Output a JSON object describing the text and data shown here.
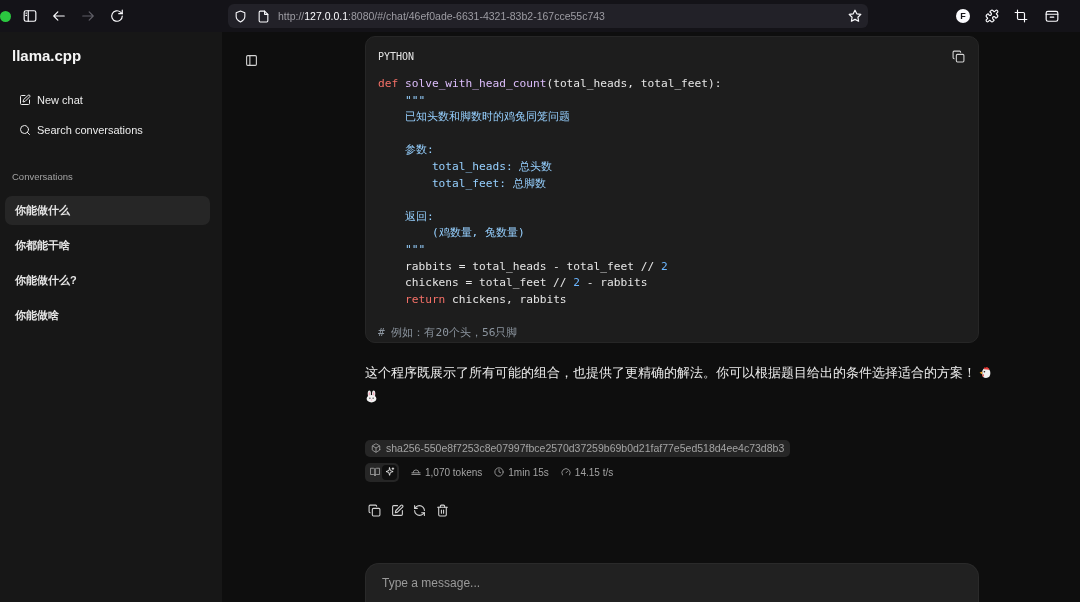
{
  "browser": {
    "nav_buttons": [
      {
        "kind": "back",
        "disabled": false
      },
      {
        "kind": "forward",
        "disabled": true
      },
      {
        "kind": "reload",
        "disabled": false
      }
    ],
    "url": {
      "scheme": "http://",
      "host": "127.0.0.1",
      "rest": ":8080/#/chat/46ef0ade-6631-4321-83b2-167cce55c743"
    },
    "profile_initial": "F"
  },
  "sidebar": {
    "title": "llama.cpp",
    "actions": [
      {
        "kind": "new_chat",
        "label": "New chat"
      },
      {
        "kind": "search",
        "label": "Search conversations"
      }
    ],
    "section_label": "Conversations",
    "conversations": [
      {
        "title": "你能做什么",
        "selected": true
      },
      {
        "title": "你都能干啥",
        "selected": false
      },
      {
        "title": "你能做什么?",
        "selected": false
      },
      {
        "title": "你能做啥",
        "selected": false
      }
    ]
  },
  "code_block": {
    "language": "PYTHON",
    "lines": [
      {
        "kind": "code",
        "tokens": [
          {
            "kind": "keyword",
            "text": "def"
          },
          {
            "kind": "function",
            "text": " solve_with_head_count"
          },
          {
            "kind": "plain",
            "text": "(total_heads, total_feet):"
          }
        ]
      },
      {
        "kind": "code",
        "tokens": [
          {
            "kind": "string",
            "text": "    \"\"\""
          }
        ]
      },
      {
        "kind": "code",
        "tokens": [
          {
            "kind": "string",
            "text": "    已知头数和脚数时的鸡兔同笼问题"
          }
        ]
      },
      {
        "kind": "blank"
      },
      {
        "kind": "code",
        "tokens": [
          {
            "kind": "string",
            "text": "    参数:"
          }
        ]
      },
      {
        "kind": "code",
        "tokens": [
          {
            "kind": "string",
            "text": "        total_heads: 总头数"
          }
        ]
      },
      {
        "kind": "code",
        "tokens": [
          {
            "kind": "string",
            "text": "        total_feet: 总脚数"
          }
        ]
      },
      {
        "kind": "blank"
      },
      {
        "kind": "code",
        "tokens": [
          {
            "kind": "string",
            "text": "    返回:"
          }
        ]
      },
      {
        "kind": "code",
        "tokens": [
          {
            "kind": "string",
            "text": "        (鸡数量, 兔数量)"
          }
        ]
      },
      {
        "kind": "code",
        "tokens": [
          {
            "kind": "string",
            "text": "    \"\"\""
          }
        ]
      },
      {
        "kind": "code",
        "tokens": [
          {
            "kind": "plain",
            "text": "    rabbits = total_heads - total_feet // "
          },
          {
            "kind": "number",
            "text": "2"
          }
        ]
      },
      {
        "kind": "code",
        "tokens": [
          {
            "kind": "plain",
            "text": "    chickens = total_feet // "
          },
          {
            "kind": "number",
            "text": "2"
          },
          {
            "kind": "plain",
            "text": " - rabbits"
          }
        ]
      },
      {
        "kind": "code",
        "tokens": [
          {
            "kind": "keyword",
            "text": "    return"
          },
          {
            "kind": "plain",
            "text": " chickens, rabbits"
          }
        ]
      },
      {
        "kind": "blank"
      },
      {
        "kind": "code",
        "tokens": [
          {
            "kind": "comment",
            "text": "# 例如：有20个头，56只脚"
          }
        ]
      }
    ]
  },
  "answer": {
    "text": "这个程序既展示了所有可能的组合，也提供了更精确的解法。你可以根据题目给出的条件选择适合的方案！"
  },
  "model_hash": "sha256-550e8f7253c8e07997fbce2570d37259b69b0d21faf77e5ed518d4ee4c73d8b3",
  "stats": {
    "view_toggle": [
      {
        "kind": "book",
        "selected": false
      },
      {
        "kind": "sparkle",
        "selected": true
      }
    ],
    "items": [
      {
        "kind": "tokens",
        "text": "1,070 tokens"
      },
      {
        "kind": "duration",
        "text": "1min 15s"
      },
      {
        "kind": "speed",
        "text": "14.15 t/s"
      }
    ]
  },
  "composer": {
    "placeholder": "Type a message..."
  }
}
